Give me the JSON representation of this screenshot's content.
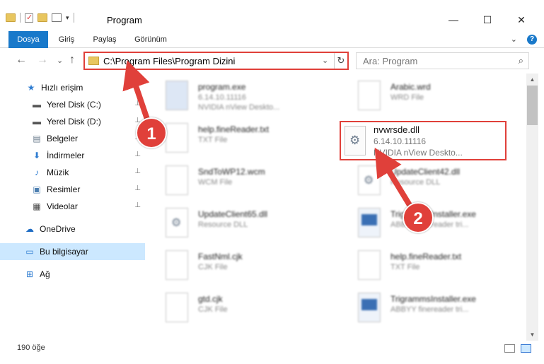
{
  "window": {
    "title": "Program",
    "minimize_glyph": "—",
    "maximize_glyph": "☐",
    "close_glyph": "✕"
  },
  "ribbon": {
    "tabs": [
      {
        "label": "Dosya",
        "active": true
      },
      {
        "label": "Giriş",
        "active": false
      },
      {
        "label": "Paylaş",
        "active": false
      },
      {
        "label": "Görünüm",
        "active": false
      }
    ],
    "expand_glyph": "⌄",
    "help_glyph": "?"
  },
  "nav": {
    "back_glyph": "←",
    "forward_glyph": "→",
    "recent_glyph": "⌄",
    "up_glyph": "↑",
    "address": "C:\\Program Files\\Program Dizini",
    "address_dropdown_glyph": "⌄",
    "refresh_glyph": "↻",
    "search_placeholder": "Ara: Program",
    "search_icon_glyph": "⌕"
  },
  "sidebar": {
    "items": [
      {
        "label": "Hızlı erişim",
        "icon": "star-icon",
        "glyph": "★",
        "color": "#2f7dd1",
        "pinned": false
      },
      {
        "label": "Yerel Disk (C:)",
        "icon": "drive-icon",
        "glyph": "▬",
        "color": "#555555",
        "pinned": true
      },
      {
        "label": "Yerel Disk (D:)",
        "icon": "drive-icon",
        "glyph": "▬",
        "color": "#555555",
        "pinned": true
      },
      {
        "label": "Belgeler",
        "icon": "documents-icon",
        "glyph": "▤",
        "color": "#6a7b8c",
        "pinned": true
      },
      {
        "label": "İndirmeler",
        "icon": "download-icon",
        "glyph": "⬇",
        "color": "#2f7dd1",
        "pinned": true
      },
      {
        "label": "Müzik",
        "icon": "music-icon",
        "glyph": "♪",
        "color": "#2f7dd1",
        "pinned": true
      },
      {
        "label": "Resimler",
        "icon": "pictures-icon",
        "glyph": "▣",
        "color": "#4d7fb0",
        "pinned": true
      },
      {
        "label": "Videolar",
        "icon": "video-icon",
        "glyph": "▦",
        "color": "#444444",
        "pinned": true
      },
      {
        "label": "OneDrive",
        "icon": "cloud-icon",
        "glyph": "☁",
        "color": "#1e6cc4",
        "pinned": false
      },
      {
        "label": "Bu bilgisayar",
        "icon": "computer-icon",
        "glyph": "▭",
        "color": "#2f7dd1",
        "pinned": false,
        "selected": true
      },
      {
        "label": "Ağ",
        "icon": "network-icon",
        "glyph": "⊞",
        "color": "#2f7dd1",
        "pinned": false
      }
    ],
    "pin_glyph": "📌"
  },
  "files": {
    "left": [
      {
        "name": "program.exe",
        "line2": "6.14.10.11116",
        "line3": "NVIDIA nView Deskto...",
        "kind": "setup"
      },
      {
        "name": "help.fineReader.txt",
        "line2": "TXT File",
        "line3": "",
        "kind": "txt"
      },
      {
        "name": "SndToWP12.wcm",
        "line2": "WCM File",
        "line3": "",
        "kind": "txt"
      },
      {
        "name": "UpdateClient65.dll",
        "line2": "Resource DLL",
        "line3": "",
        "kind": "dll"
      },
      {
        "name": "FastNml.cjk",
        "line2": "CJK File",
        "line3": "",
        "kind": "txt"
      },
      {
        "name": "gtd.cjk",
        "line2": "CJK File",
        "line3": "",
        "kind": "txt"
      }
    ],
    "right": [
      {
        "name": "Arabic.wrd",
        "line2": "WRD File",
        "line3": "",
        "kind": "txt"
      },
      {
        "name": "",
        "line2": "",
        "line3": "",
        "kind": "none"
      },
      {
        "name": "UpdateClient42.dll",
        "line2": "Resource DLL",
        "line3": "",
        "kind": "dll"
      },
      {
        "name": "TrigrammsInstaller.exe",
        "line2": "ABBYY finereader tri...",
        "line3": "",
        "kind": "exe"
      },
      {
        "name": "help.fineReader.txt",
        "line2": "TXT File",
        "line3": "",
        "kind": "txt"
      },
      {
        "name": "TrigrammsInstaller.exe",
        "line2": "ABBYY finereader tri...",
        "line3": "",
        "kind": "exe"
      }
    ],
    "highlighted": {
      "name": "nvwrsde.dll",
      "line2": "6.14.10.11116",
      "line3": "NVIDIA nView Deskto..."
    }
  },
  "status": {
    "item_count": "190 öğe"
  },
  "annotations": {
    "badge1": "1",
    "badge2": "2",
    "color": "#e0403a"
  }
}
